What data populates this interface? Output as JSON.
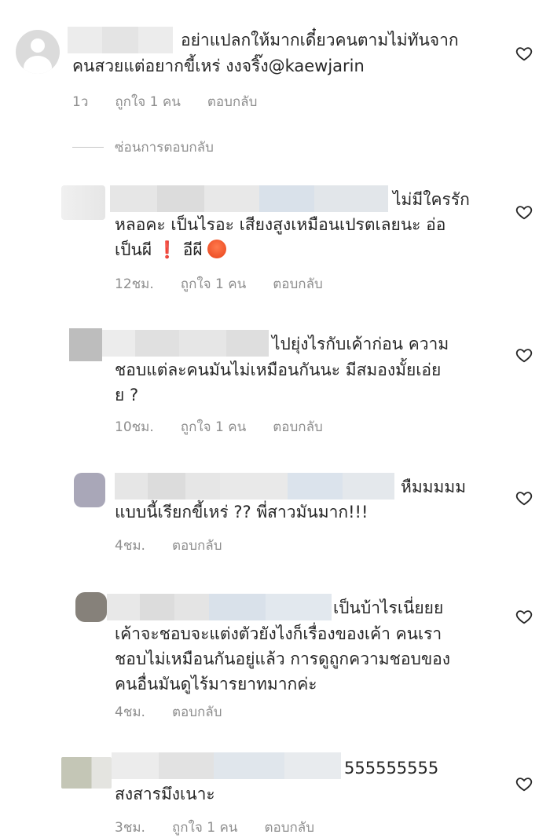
{
  "comments": [
    {
      "lines": [
        "อย่าแปลกให้มากเดี๋ยวคนตามไม่ทันจาก",
        "คนสวยแต่อยากขี้เหร่ งงจริ๊ง@kaewjarin"
      ],
      "time": "1ว",
      "likes": "ถูกใจ 1 คน",
      "reply": "ตอบกลับ"
    },
    {
      "lines": [
        "ไม่มีใครรัก",
        "หลอคะ เป็นไรอะ เสียงสูงเหมือนเปรตเลยนะ อ่อ",
        "เป็นผี",
        "อีผี"
      ],
      "time": "12ชม.",
      "likes": "ถูกใจ 1 คน",
      "reply": "ตอบกลับ"
    },
    {
      "lines": [
        "ไปยุ่งไรกับเค้าก่อน ความ",
        "ชอบแต่ละคนมันไม่เหมือนกันนะ มีสมองมั้ยเอ่ย",
        "ย ?"
      ],
      "time": "10ชม.",
      "likes": "ถูกใจ 1 คน",
      "reply": "ตอบกลับ"
    },
    {
      "lines": [
        "หืมมมมม",
        "แบบนี้เรียกขี้เหร่ ?? พี่สาวมันมาก!!!"
      ],
      "time": "4ชม.",
      "reply": "ตอบกลับ"
    },
    {
      "lines": [
        "เป็นบ้าไรเนี่ยยย",
        "เค้าจะชอบจะแต่งตัวยังไงก็เรื่องของเค้า คนเรา",
        "ชอบไม่เหมือนกันอยู่แล้ว การดูถูกความชอบของ",
        "คนอื่นมันดูไร้มารยาทมากค่ะ"
      ],
      "time": "4ชม.",
      "reply": "ตอบกลับ"
    },
    {
      "lines": [
        "555555555",
        "สงสารมึงเนาะ"
      ],
      "time": "3ชม.",
      "likes": "ถูกใจ 1 คน",
      "reply": "ตอบกลับ"
    }
  ],
  "hide_replies": "ซ่อนการตอบกลับ",
  "icons": {
    "heart": "heart-outline-icon",
    "emoji": "angry-face-emoji",
    "exclaim": "red-exclamation-mark"
  },
  "colors": {
    "text": "#262626",
    "meta": "#8e8e8e",
    "blur_light": "#ececec",
    "blur_mid": "#dcdcdc",
    "blur_blue": "#d9e1ea"
  }
}
